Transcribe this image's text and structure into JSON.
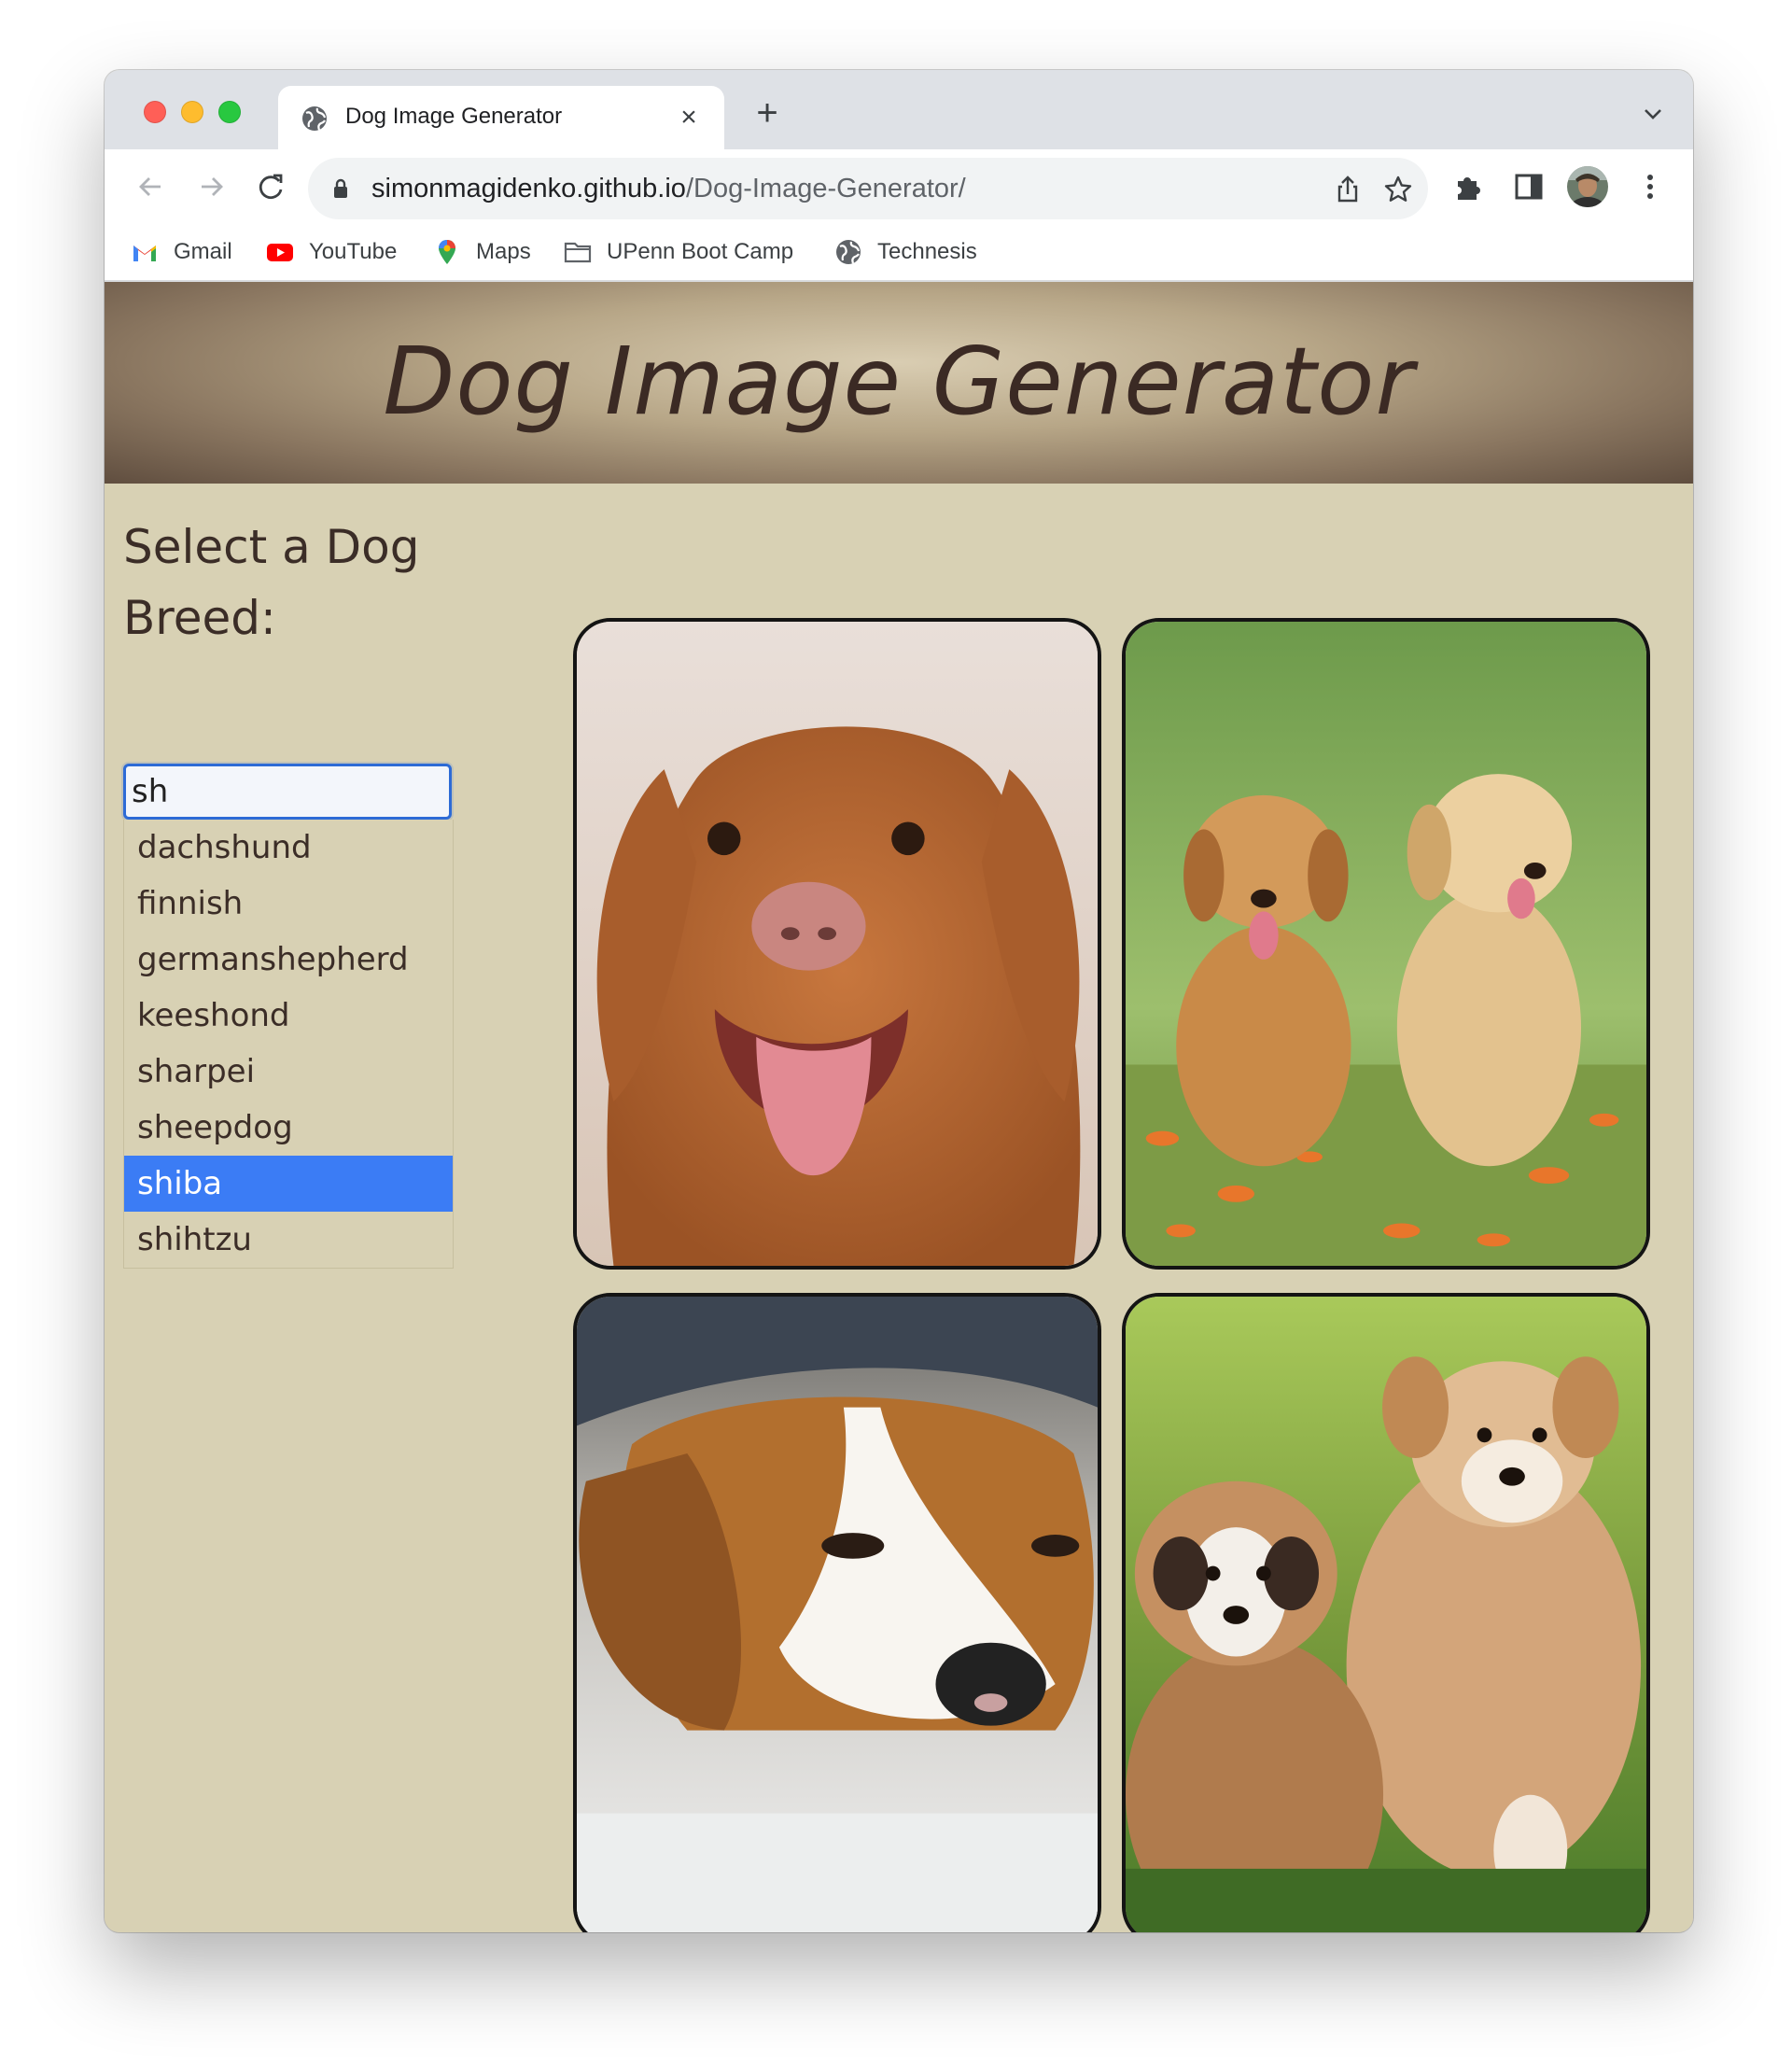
{
  "browser": {
    "tab_title": "Dog Image Generator",
    "url_host": "simonmagidenko.github.io",
    "url_path": "/Dog-Image-Generator/",
    "bookmarks": [
      {
        "label": "Gmail",
        "icon": "gmail-icon"
      },
      {
        "label": "YouTube",
        "icon": "youtube-icon"
      },
      {
        "label": "Maps",
        "icon": "maps-icon"
      },
      {
        "label": "UPenn Boot Camp",
        "icon": "folder-icon"
      },
      {
        "label": "Technesis",
        "icon": "globe-icon"
      }
    ]
  },
  "page": {
    "title": "Dog Image Generator",
    "heading": "Select a Dog Breed:",
    "search_value": "sh",
    "suggestions": [
      "dachshund",
      "finnish",
      "germanshepherd",
      "keeshond",
      "sharpei",
      "sheepdog",
      "shiba",
      "shihtzu"
    ],
    "selected_suggestion": "shiba",
    "colors": {
      "page_bg": "#d8d1b4",
      "title_text": "#3b2a24",
      "selection": "#3b7cf5",
      "input_focus": "#2d6bd6"
    },
    "images": [
      {
        "subject": "brown retriever dog smiling"
      },
      {
        "subject": "two golden puppies on grass"
      },
      {
        "subject": "beagle lying on the floor"
      },
      {
        "subject": "two fluffy puppies running on grass"
      }
    ]
  }
}
